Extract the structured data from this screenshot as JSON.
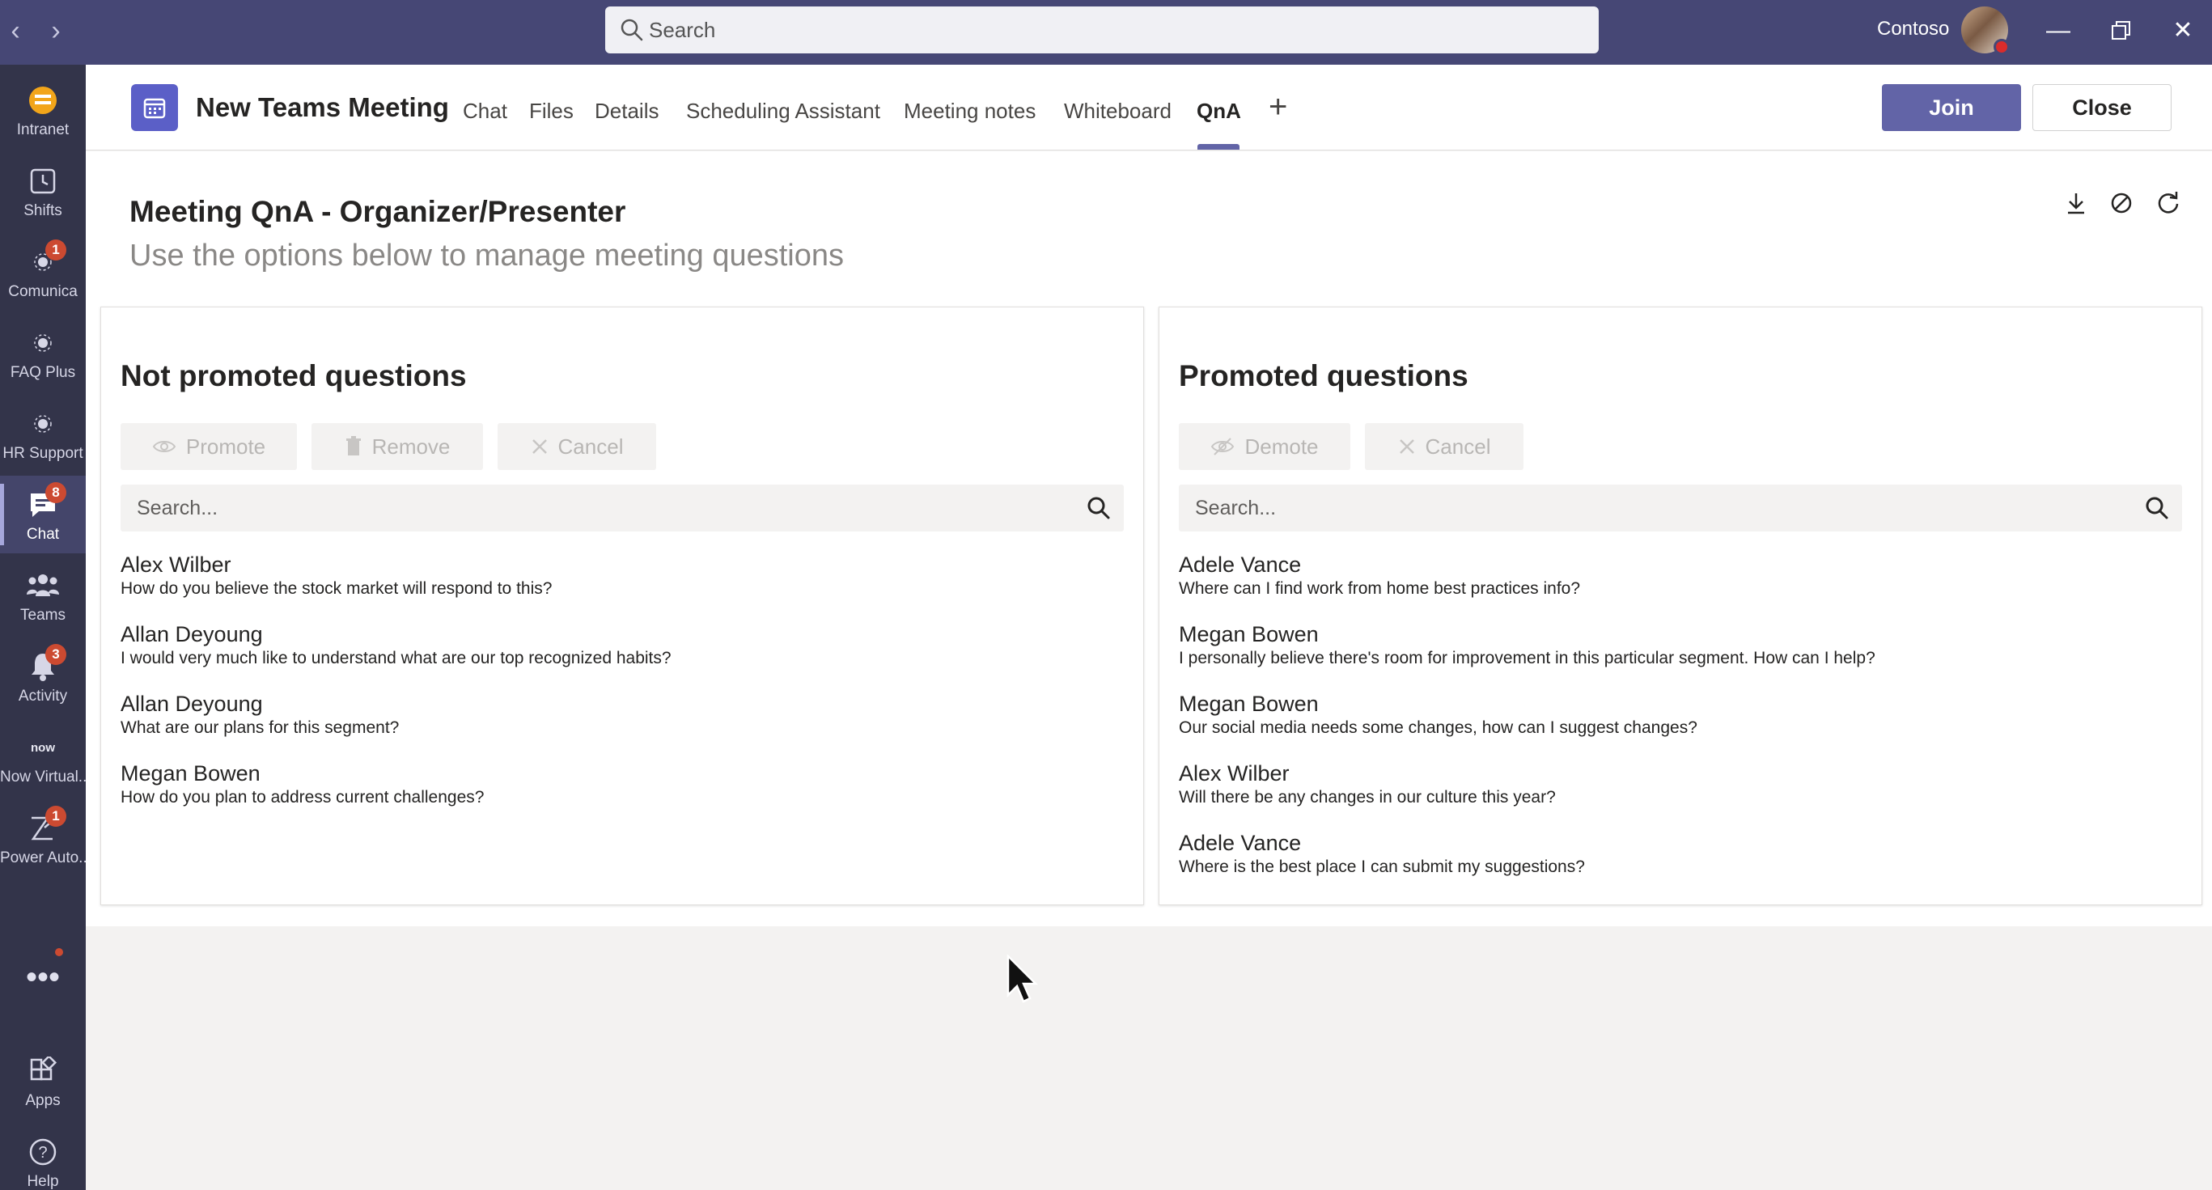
{
  "titlebar": {
    "search_placeholder": "Search",
    "tenant": "Contoso",
    "colors": {
      "background": "#464775",
      "presence_busy": "#d92c2c"
    }
  },
  "rail": {
    "items": [
      {
        "label": "Intranet",
        "icon": "intranet-icon",
        "badge": ""
      },
      {
        "label": "Shifts",
        "icon": "shifts-icon",
        "badge": ""
      },
      {
        "label": "Comunica",
        "icon": "comunica-icon",
        "badge": "1"
      },
      {
        "label": "FAQ Plus",
        "icon": "faq-plus-icon",
        "badge": ""
      },
      {
        "label": "HR Support",
        "icon": "hr-support-icon",
        "badge": ""
      },
      {
        "label": "Chat",
        "icon": "chat-icon",
        "badge": "8",
        "active": true
      },
      {
        "label": "Teams",
        "icon": "teams-icon",
        "badge": ""
      },
      {
        "label": "Activity",
        "icon": "activity-icon",
        "badge": "3"
      },
      {
        "label": "Now Virtual...",
        "icon": "now-virtual-icon",
        "icon_text": "now",
        "badge": ""
      },
      {
        "label": "Power Auto...",
        "icon": "power-automate-icon",
        "badge": "1"
      }
    ],
    "more": "•••",
    "bottom": [
      {
        "label": "Apps",
        "icon": "apps-icon"
      },
      {
        "label": "Help",
        "icon": "help-icon"
      }
    ]
  },
  "header": {
    "title": "New Teams Meeting",
    "tabs": [
      "Chat",
      "Files",
      "Details",
      "Scheduling Assistant",
      "Meeting notes",
      "Whiteboard",
      "QnA"
    ],
    "active_tab": "QnA",
    "add_tab": "+",
    "join_label": "Join",
    "close_label": "Close",
    "colors": {
      "accent": "#6264a7"
    }
  },
  "qna": {
    "title": "Meeting QnA - Organizer/Presenter",
    "subtitle": "Use the options below to manage meeting questions",
    "toolbar_icons": [
      "download-icon",
      "block-icon",
      "refresh-icon"
    ]
  },
  "not_promoted": {
    "title": "Not promoted questions",
    "buttons": {
      "promote": "Promote",
      "remove": "Remove",
      "cancel": "Cancel"
    },
    "search_placeholder": "Search...",
    "questions": [
      {
        "author": "Alex Wilber",
        "text": "How do you believe the stock market will respond to this?"
      },
      {
        "author": "Allan Deyoung",
        "text": "I would very much like to understand what are our top recognized habits?"
      },
      {
        "author": "Allan Deyoung",
        "text": "What are our plans for this segment?"
      },
      {
        "author": "Megan Bowen",
        "text": "How do you plan to address current challenges?"
      }
    ]
  },
  "promoted": {
    "title": "Promoted questions",
    "buttons": {
      "demote": "Demote",
      "cancel": "Cancel"
    },
    "search_placeholder": "Search...",
    "questions": [
      {
        "author": "Adele Vance",
        "text": "Where can I find work from home best practices info?"
      },
      {
        "author": "Megan Bowen",
        "text": "I personally believe there's room for improvement in this particular segment. How can I help?"
      },
      {
        "author": "Megan Bowen",
        "text": "Our social media needs some changes, how can I suggest changes?"
      },
      {
        "author": "Alex Wilber",
        "text": "Will there be any changes in our culture this year?"
      },
      {
        "author": "Adele Vance",
        "text": "Where is the best place I can submit my suggestions?"
      }
    ]
  }
}
